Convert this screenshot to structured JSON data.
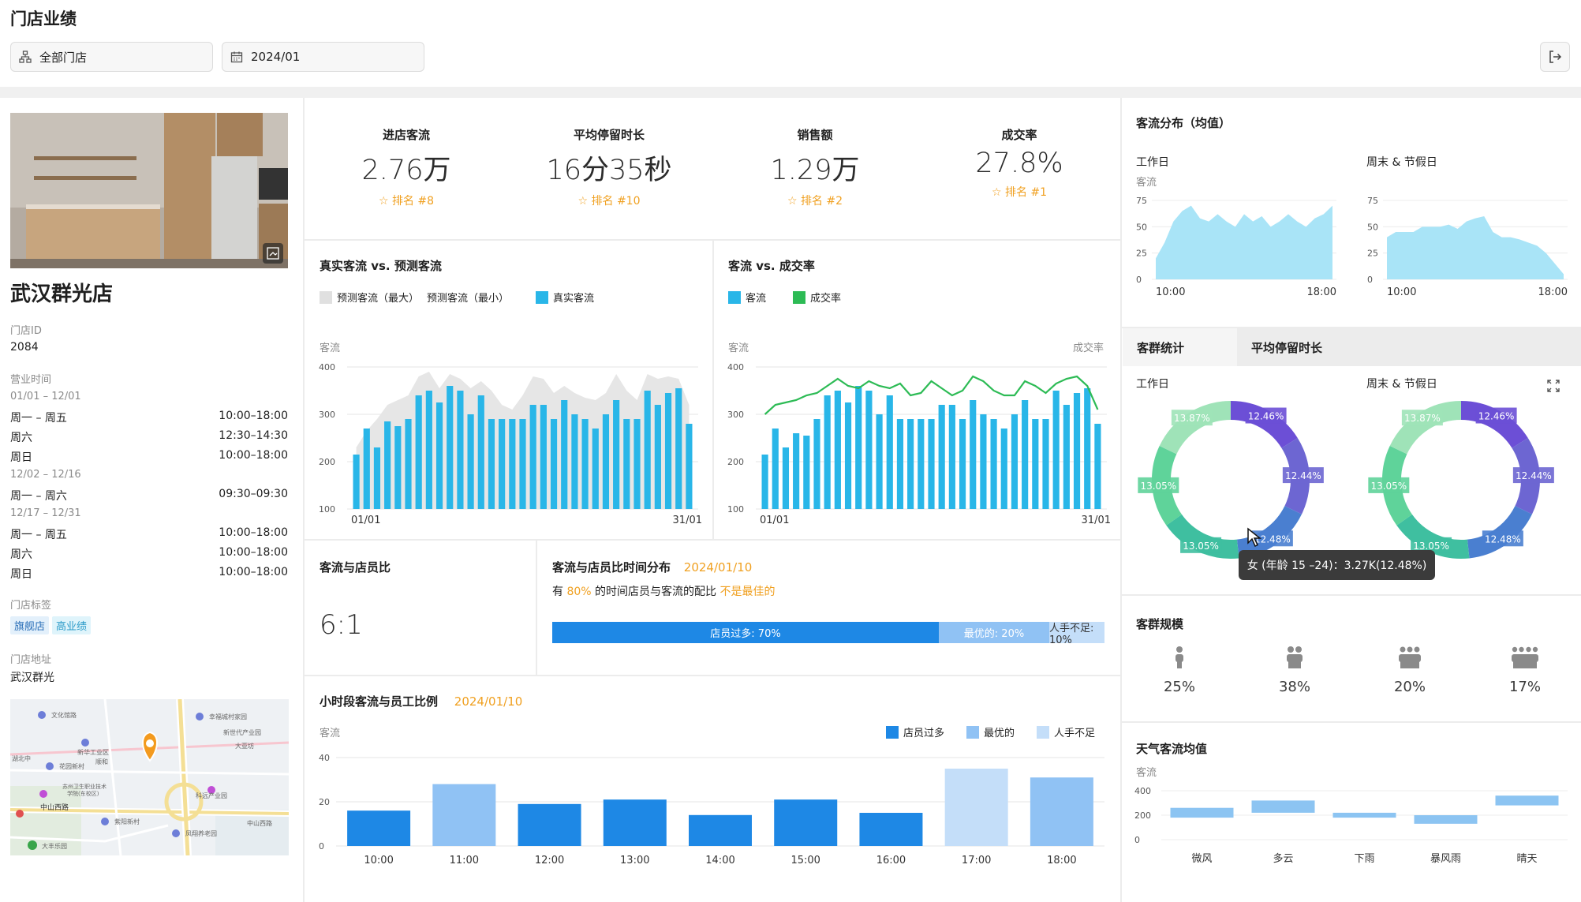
{
  "header": {
    "title": "门店业绩",
    "store_select": "全部门店",
    "date_select": "2024/01"
  },
  "store": {
    "name": "武汉群光店",
    "id_label": "门店ID",
    "id": "2084",
    "hours_label": "营业时间",
    "hours": [
      {
        "period": "01/01 – 12/01",
        "rows": [
          {
            "day": "周一 – 周五",
            "time": "10:00–18:00"
          },
          {
            "day": "周六",
            "time": "12:30–14:30"
          },
          {
            "day": "周日",
            "time": "10:00–18:00"
          }
        ]
      },
      {
        "period": "12/02 – 12/16",
        "rows": [
          {
            "day": "周一 – 周六",
            "time": "09:30–09:30"
          }
        ]
      },
      {
        "period": "12/17 – 12/31",
        "rows": [
          {
            "day": "周一 – 周五",
            "time": "10:00–18:00"
          },
          {
            "day": "周六",
            "time": "10:00–18:00"
          },
          {
            "day": "周日",
            "time": "10:00–18:00"
          }
        ]
      }
    ],
    "tags_label": "门店标签",
    "tags": [
      "旗舰店",
      "高业绩"
    ],
    "address_label": "门店地址",
    "address": "武汉群光",
    "map_labels": [
      "文化馆路",
      "幸福城村家园",
      "新华工业区",
      "顺和",
      "湖北中",
      "新世代产业园",
      "大亚坊",
      "花园新村",
      "苏州卫生职业技术学院(东校区)",
      "中山西路",
      "紫阳新村",
      "科远产业园",
      "凤翔养老园",
      "大丰乐园",
      "中山西路"
    ]
  },
  "kpis": [
    {
      "label": "进店客流",
      "value": "2.76万",
      "rank": "排名 #8"
    },
    {
      "label": "平均停留时长",
      "value": "16分35秒",
      "rank": "排名 #10"
    },
    {
      "label": "销售额",
      "value": "1.29万",
      "rank": "排名 #2"
    },
    {
      "label": "成交率",
      "value": "27.8%",
      "rank": "排名 #1"
    }
  ],
  "chart_data": [
    {
      "type": "bar",
      "title": "真实客流 vs. 预测客流",
      "legend": [
        "预测客流（最大）",
        "预测客流（最小）",
        "真实客流"
      ],
      "ylabel": "客流",
      "ylim": [
        100,
        400
      ],
      "yticks": [
        100,
        200,
        300,
        400
      ],
      "x_start": "01/01",
      "x_end": "31/01",
      "series": [
        {
          "name": "真实客流",
          "values": [
            215,
            270,
            230,
            285,
            275,
            290,
            340,
            350,
            325,
            360,
            350,
            300,
            340,
            290,
            290,
            290,
            290,
            320,
            320,
            290,
            330,
            300,
            290,
            270,
            300,
            330,
            290,
            290,
            350,
            320,
            345,
            355,
            280
          ]
        },
        {
          "name": "预测客流（最大）",
          "values": [
            230,
            265,
            290,
            320,
            330,
            340,
            380,
            390,
            355,
            385,
            375,
            355,
            370,
            350,
            320,
            310,
            340,
            380,
            375,
            345,
            360,
            345,
            335,
            330,
            345,
            385,
            350,
            330,
            385,
            375,
            380,
            375,
            320
          ]
        }
      ],
      "colors": {
        "real": "#29b6e8",
        "forecast": "#e6e6e6"
      }
    },
    {
      "type": "bar",
      "title": "客流 vs. 成交率",
      "legend": [
        "客流",
        "成交率"
      ],
      "ylabel": "客流",
      "y2label": "成交率",
      "ylim": [
        100,
        400
      ],
      "yticks": [
        100,
        200,
        300,
        400
      ],
      "x_start": "01/01",
      "x_end": "31/01",
      "series": [
        {
          "name": "客流",
          "values": [
            215,
            270,
            230,
            260,
            255,
            290,
            340,
            350,
            325,
            360,
            350,
            300,
            340,
            290,
            290,
            290,
            290,
            320,
            320,
            290,
            330,
            300,
            290,
            270,
            300,
            330,
            290,
            290,
            350,
            320,
            345,
            355,
            280
          ]
        },
        {
          "name": "成交率",
          "values": [
            300,
            320,
            325,
            330,
            340,
            345,
            360,
            375,
            360,
            355,
            370,
            360,
            355,
            365,
            340,
            345,
            370,
            355,
            340,
            350,
            380,
            370,
            350,
            340,
            340,
            370,
            360,
            345,
            365,
            375,
            380,
            360,
            310
          ]
        }
      ],
      "colors": {
        "bar": "#29b6e8",
        "line": "#2dbb55"
      }
    },
    {
      "type": "bar",
      "title": "小时段客流与员工比例",
      "date": "2024/01/10",
      "legend": [
        "店员过多",
        "最优的",
        "人手不足"
      ],
      "ylabel": "客流",
      "ylim": [
        0,
        40
      ],
      "yticks": [
        0,
        20,
        40
      ],
      "categories": [
        "10:00",
        "11:00",
        "12:00",
        "13:00",
        "14:00",
        "15:00",
        "16:00",
        "17:00",
        "18:00"
      ],
      "values": [
        16,
        28,
        19,
        21,
        14,
        21,
        15,
        35,
        31
      ],
      "kinds": [
        0,
        1,
        0,
        0,
        0,
        0,
        0,
        2,
        1
      ],
      "colors": [
        "#1e88e5",
        "#90c2f4",
        "#c4def9"
      ]
    },
    {
      "type": "area",
      "title": "客流分布（均值）",
      "groups": [
        {
          "name": "工作日",
          "ylabel": "客流",
          "yticks": [
            0,
            25,
            50,
            75
          ],
          "x_start": "10:00",
          "x_end": "18:00",
          "values": [
            20,
            35,
            55,
            65,
            70,
            58,
            55,
            62,
            55,
            50,
            62,
            55,
            60,
            50,
            55,
            62,
            55,
            50,
            58,
            62,
            70
          ]
        },
        {
          "name": "周末 & 节假日",
          "yticks": [
            0,
            25,
            50,
            75
          ],
          "x_start": "10:00",
          "x_end": "18:00",
          "values": [
            40,
            45,
            45,
            45,
            50,
            50,
            50,
            52,
            48,
            55,
            58,
            60,
            45,
            40,
            40,
            38,
            35,
            32,
            25,
            15,
            5
          ]
        }
      ],
      "color": "#a9e4f7"
    },
    {
      "type": "pie",
      "title": "客群统计",
      "groups": [
        "工作日",
        "周末 & 节假日"
      ],
      "slices": [
        {
          "label": "12.46%",
          "value": 12.46,
          "color": "#6c4fd6"
        },
        {
          "label": "12.44%",
          "value": 12.44,
          "color": "#6d66d2"
        },
        {
          "label": "12.48%",
          "value": 12.48,
          "color": "#4a7fd0"
        },
        {
          "label": "13.05%",
          "value": 13.05,
          "color": "#3fbfa0"
        },
        {
          "label": "13.05%",
          "value": 13.05,
          "color": "#5fd39a"
        },
        {
          "label": "13.87%",
          "value": 13.87,
          "color": "#9fe3b8"
        }
      ]
    },
    {
      "type": "bar",
      "title": "天气客流均值",
      "ylabel": "客流",
      "yticks": [
        0,
        200,
        400
      ],
      "categories": [
        "微风",
        "多云",
        "下雨",
        "暴风雨",
        "晴天"
      ],
      "ranges": [
        [
          180,
          260
        ],
        [
          220,
          320
        ],
        [
          180,
          220
        ],
        [
          130,
          200
        ],
        [
          280,
          360
        ]
      ],
      "color": "#8cc4f2"
    }
  ],
  "ratio": {
    "title": "客流与店员比",
    "value": "6:1"
  },
  "ratio_time": {
    "title": "客流与店员比时间分布",
    "date": "2024/01/10",
    "desc_pre": "有",
    "desc_pct": "80%",
    "desc_mid": "的时间店员与客流的配比",
    "desc_end": "不是最佳的",
    "segments": [
      {
        "label": "店员过多: 70%",
        "value": 70,
        "color": "#1e88e5",
        "text": "#ffffff"
      },
      {
        "label": "最优的: 20%",
        "value": 20,
        "color": "#90c2f4",
        "text": "#ffffff"
      },
      {
        "label": "人手不足: 10%",
        "value": 10,
        "color": "#c4def9",
        "text": "#333333"
      }
    ]
  },
  "tabs": [
    "客群统计",
    "平均停留时长"
  ],
  "tooltip": "女 (年龄 15 –24)：3.27K(12.48%)",
  "group_size": {
    "title": "客群规模",
    "items": [
      {
        "pct": "25%",
        "count": 1
      },
      {
        "pct": "38%",
        "count": 2
      },
      {
        "pct": "20%",
        "count": 3
      },
      {
        "pct": "17%",
        "count": 4
      }
    ]
  }
}
